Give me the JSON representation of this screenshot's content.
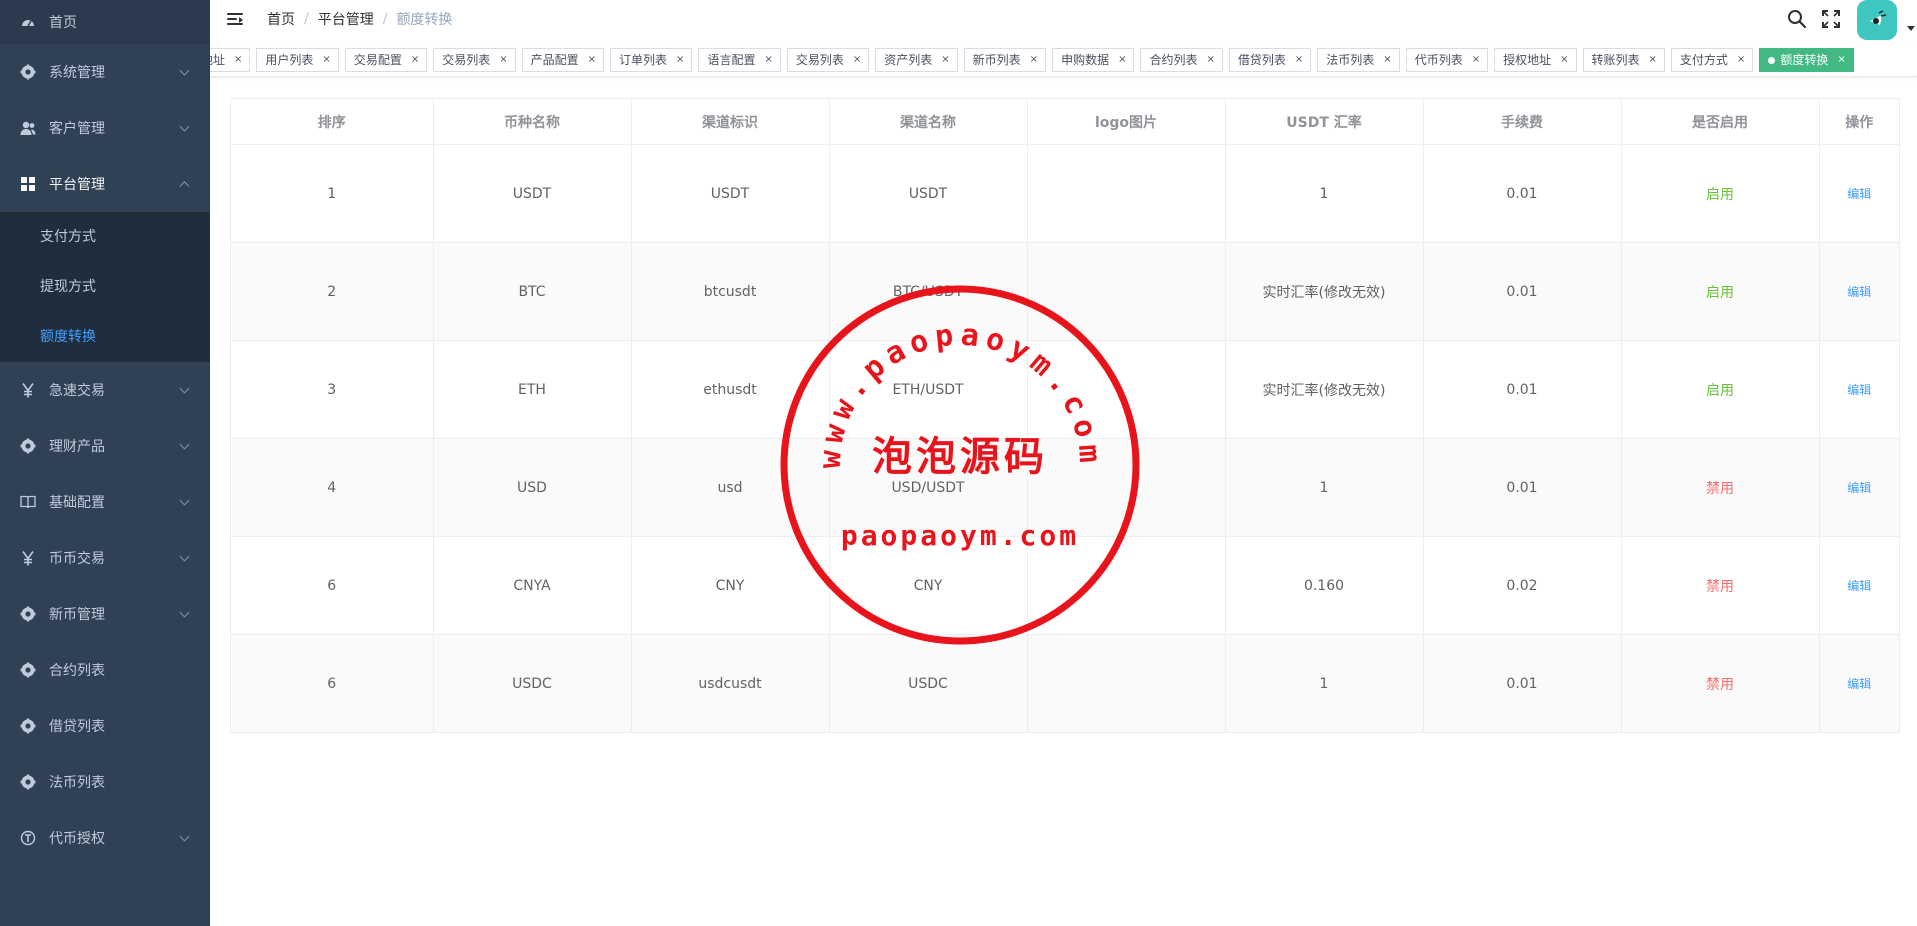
{
  "sidebar": {
    "items": [
      {
        "label": "首页",
        "icon": "dashboard-icon",
        "expandable": false
      },
      {
        "label": "系统管理",
        "icon": "gear-icon",
        "expandable": true
      },
      {
        "label": "客户管理",
        "icon": "user-icon",
        "expandable": true
      },
      {
        "label": "平台管理",
        "icon": "grid-icon",
        "expandable": true,
        "open": true,
        "children": [
          {
            "label": "支付方式",
            "active": false
          },
          {
            "label": "提现方式",
            "active": false
          },
          {
            "label": "额度转换",
            "active": true
          }
        ]
      },
      {
        "label": "急速交易",
        "icon": "yen-icon",
        "expandable": true
      },
      {
        "label": "理财产品",
        "icon": "gear-icon",
        "expandable": true
      },
      {
        "label": "基础配置",
        "icon": "book-icon",
        "expandable": true
      },
      {
        "label": "币币交易",
        "icon": "yen-icon",
        "expandable": true
      },
      {
        "label": "新币管理",
        "icon": "gear-icon",
        "expandable": true
      },
      {
        "label": "合约列表",
        "icon": "gear-icon",
        "expandable": false
      },
      {
        "label": "借贷列表",
        "icon": "gear-icon",
        "expandable": false
      },
      {
        "label": "法币列表",
        "icon": "gear-icon",
        "expandable": false
      },
      {
        "label": "代币授权",
        "icon": "token-icon",
        "expandable": true
      }
    ]
  },
  "breadcrumb": [
    "首页",
    "平台管理",
    "额度转换"
  ],
  "breadcrumb_separator": "/",
  "tags": [
    {
      "label": "地址",
      "active": false
    },
    {
      "label": "用户列表",
      "active": false
    },
    {
      "label": "交易配置",
      "active": false
    },
    {
      "label": "交易列表",
      "active": false
    },
    {
      "label": "产品配置",
      "active": false
    },
    {
      "label": "订单列表",
      "active": false
    },
    {
      "label": "语言配置",
      "active": false
    },
    {
      "label": "交易列表",
      "active": false
    },
    {
      "label": "资产列表",
      "active": false
    },
    {
      "label": "新币列表",
      "active": false
    },
    {
      "label": "申购数据",
      "active": false
    },
    {
      "label": "合约列表",
      "active": false
    },
    {
      "label": "借贷列表",
      "active": false
    },
    {
      "label": "法币列表",
      "active": false
    },
    {
      "label": "代币列表",
      "active": false
    },
    {
      "label": "授权地址",
      "active": false
    },
    {
      "label": "转账列表",
      "active": false
    },
    {
      "label": "支付方式",
      "active": false
    },
    {
      "label": "额度转换",
      "active": true
    }
  ],
  "tag_close": "×",
  "table": {
    "headers": [
      "排序",
      "币种名称",
      "渠道标识",
      "渠道名称",
      "logo图片",
      "USDT 汇率",
      "手续费",
      "是否启用",
      "操作"
    ],
    "rows": [
      {
        "sort": "1",
        "coin": "USDT",
        "channel_id": "USDT",
        "channel_name": "USDT",
        "logo": "",
        "rate": "1",
        "fee": "0.01",
        "status": "启用",
        "enabled": true,
        "action": "编辑"
      },
      {
        "sort": "2",
        "coin": "BTC",
        "channel_id": "btcusdt",
        "channel_name": "BTC/USDT",
        "logo": "",
        "rate": "实时汇率(修改无效)",
        "fee": "0.01",
        "status": "启用",
        "enabled": true,
        "action": "编辑"
      },
      {
        "sort": "3",
        "coin": "ETH",
        "channel_id": "ethusdt",
        "channel_name": "ETH/USDT",
        "logo": "",
        "rate": "实时汇率(修改无效)",
        "fee": "0.01",
        "status": "启用",
        "enabled": true,
        "action": "编辑"
      },
      {
        "sort": "4",
        "coin": "USD",
        "channel_id": "usd",
        "channel_name": "USD/USDT",
        "logo": "",
        "rate": "1",
        "fee": "0.01",
        "status": "禁用",
        "enabled": false,
        "action": "编辑"
      },
      {
        "sort": "6",
        "coin": "CNYA",
        "channel_id": "CNY",
        "channel_name": "CNY",
        "logo": "",
        "rate": "0.160",
        "fee": "0.02",
        "status": "禁用",
        "enabled": false,
        "action": "编辑"
      },
      {
        "sort": "6",
        "coin": "USDC",
        "channel_id": "usdcusdt",
        "channel_name": "USDC",
        "logo": "",
        "rate": "1",
        "fee": "0.01",
        "status": "禁用",
        "enabled": false,
        "action": "编辑"
      }
    ]
  },
  "watermark": {
    "ring_text": "www.paopaoym.com",
    "center_text": "泡泡源码",
    "bottom_text": "paopaoym.com",
    "color": "#e8141b"
  },
  "colors": {
    "sidebar_bg": "#304156",
    "active_menu": "#409eff",
    "tag_active": "#42b983",
    "enabled": "#67c23a",
    "disabled": "#f56c6c",
    "avatar_bg": "#3fc6c0"
  }
}
